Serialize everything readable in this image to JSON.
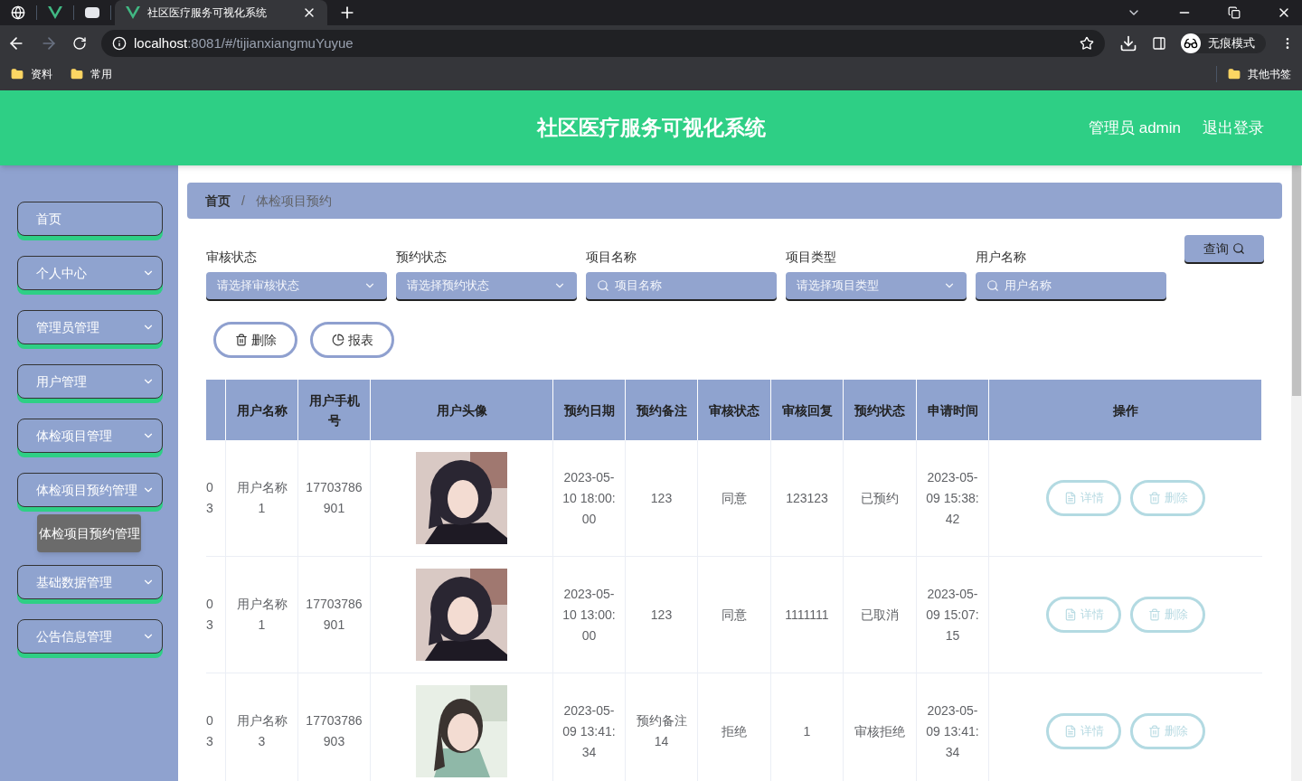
{
  "browser": {
    "tabs": [
      {
        "kind": "globe"
      },
      {
        "kind": "vue"
      },
      {
        "kind": "window"
      },
      {
        "kind": "vue",
        "title": "社区医疗服务可视化系统"
      }
    ],
    "address": {
      "host": "localhost",
      "path": ":8081/#/tijianxiangmuYuyue"
    },
    "profile": "无痕模式",
    "bookmarks": [
      "资料",
      "常用"
    ],
    "other_bookmarks": "其他书签"
  },
  "header": {
    "title": "社区医疗服务可视化系统",
    "user": "管理员 admin",
    "logout": "退出登录"
  },
  "sidebar": {
    "items": [
      {
        "label": "首页",
        "kind": "link"
      },
      {
        "label": "个人中心",
        "kind": "submenu"
      },
      {
        "label": "管理员管理",
        "kind": "submenu"
      },
      {
        "label": "用户管理",
        "kind": "submenu"
      },
      {
        "label": "体检项目管理",
        "kind": "submenu"
      },
      {
        "label": "体检项目预约管理",
        "kind": "submenu",
        "children": [
          {
            "label": "体检项目预约管理",
            "selected": true
          }
        ]
      },
      {
        "label": "基础数据管理",
        "kind": "submenu"
      },
      {
        "label": "公告信息管理",
        "kind": "submenu"
      }
    ]
  },
  "breadcrumb": [
    "首页",
    "体检项目预约"
  ],
  "breadcrumb_separator": "/",
  "filters": [
    {
      "label": "审核状态",
      "kind": "select",
      "placeholder": "请选择审核状态"
    },
    {
      "label": "预约状态",
      "kind": "select",
      "placeholder": "请选择预约状态"
    },
    {
      "label": "项目名称",
      "kind": "search",
      "placeholder": "项目名称"
    },
    {
      "label": "项目类型",
      "kind": "select",
      "placeholder": "请选择项目类型"
    },
    {
      "label": "用户名称",
      "kind": "search",
      "placeholder": "用户名称"
    }
  ],
  "query_button": "查询",
  "actions": [
    {
      "kind": "delete",
      "label": "删除"
    },
    {
      "kind": "report",
      "label": "报表"
    }
  ],
  "table": {
    "columns": [
      "",
      "用户名称",
      "用户手机号",
      "用户头像",
      "预约日期",
      "预约备注",
      "审核状态",
      "审核回复",
      "预约状态",
      "申请时间",
      "操作"
    ],
    "rows": [
      {
        "column_1": "0 3",
        "user": "用户名称1",
        "phone": "17703786901",
        "date": "2023-05-10 18:00:00",
        "note": "123",
        "review": "同意",
        "reply": "123123",
        "status": "已预约",
        "applied": "2023-05-09 15:38:42",
        "buttons": [
          "详情",
          "删除"
        ]
      },
      {
        "column_1": "0 3",
        "user": "用户名称1",
        "phone": "17703786901",
        "date": "2023-05-10 13:00:00",
        "note": "123",
        "review": "同意",
        "reply": "1111111",
        "status": "已取消",
        "applied": "2023-05-09 15:07:15",
        "buttons": [
          "详情",
          "删除"
        ]
      },
      {
        "column_1": "0 3",
        "user": "用户名称3",
        "phone": "17703786903",
        "date": "2023-05-09 13:41:34",
        "note": "预约备注14",
        "review": "拒绝",
        "reply": "1",
        "status": "审核拒绝",
        "applied": "2023-05-09 13:41:34",
        "buttons": [
          "详情",
          "删除"
        ]
      }
    ]
  }
}
